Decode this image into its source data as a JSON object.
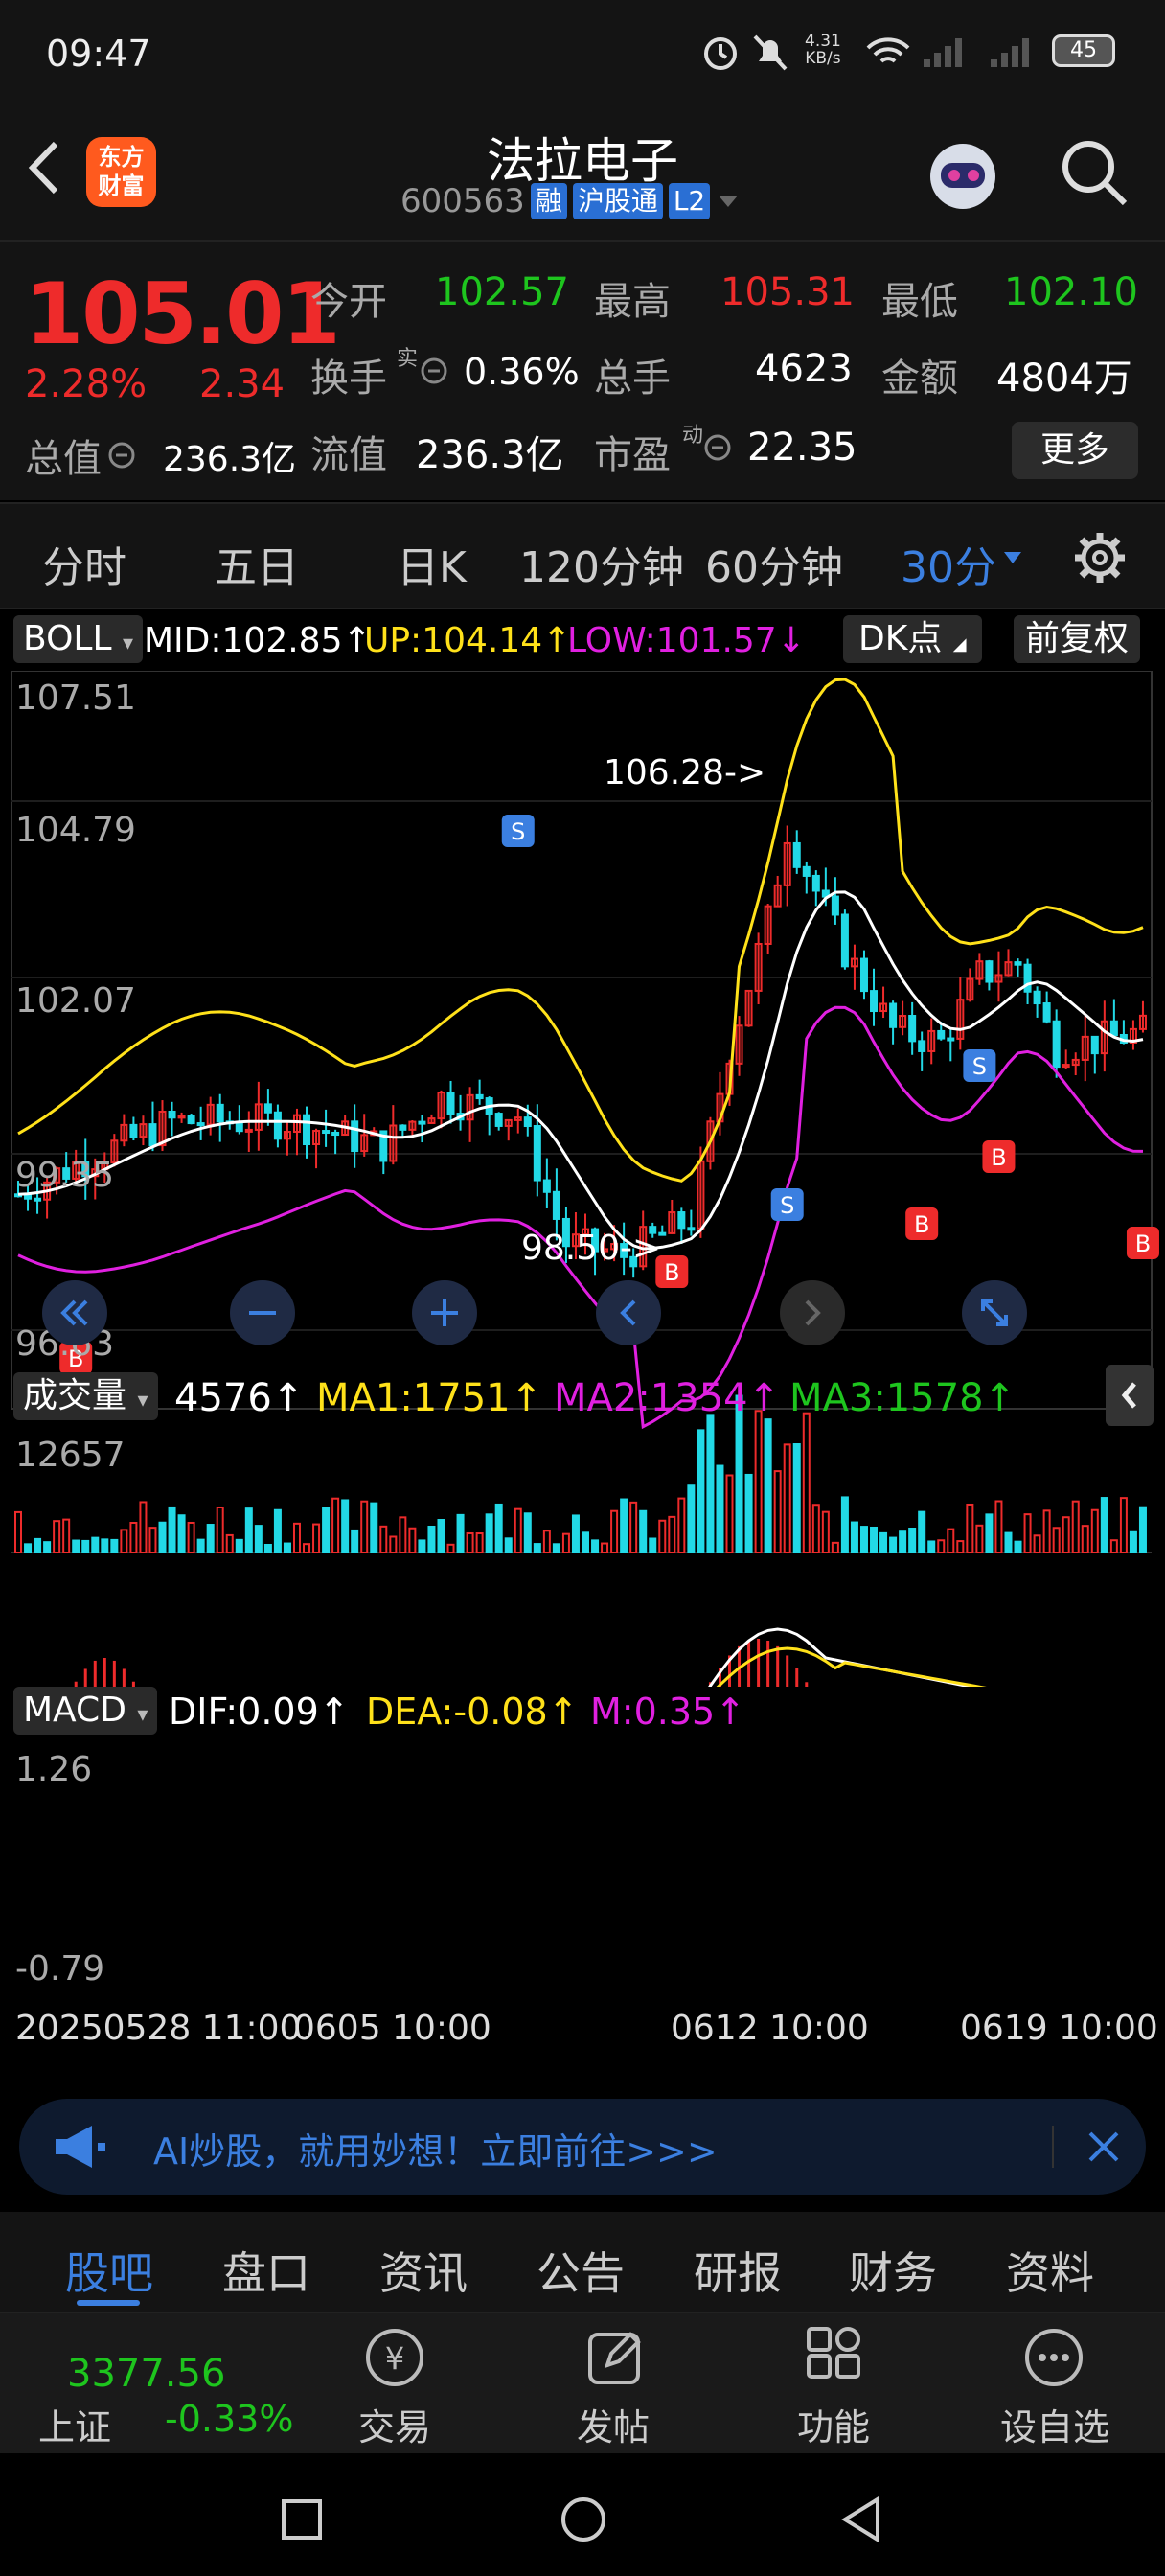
{
  "status": {
    "time": "09:47",
    "net_speed_top": "4.31",
    "net_speed_unit": "KB/s",
    "battery": "45"
  },
  "header": {
    "title": "法拉电子",
    "code": "600563",
    "tags": [
      "融",
      "沪股通",
      "L2"
    ],
    "logo_line1": "东方",
    "logo_line2": "财富"
  },
  "quote": {
    "price": "105.01",
    "change_pct": "2.28%",
    "change": "2.34",
    "open_label": "今开",
    "open": "102.57",
    "high_label": "最高",
    "high": "105.31",
    "low_label": "最低",
    "low": "102.10",
    "turnover_label": "换手",
    "turnover_sup": "实",
    "turnover": "0.36%",
    "volume_label": "总手",
    "volume": "4623",
    "amount_label": "金额",
    "amount": "4804万",
    "mcap_label": "总值",
    "mcap": "236.3亿",
    "float_label": "流值",
    "float": "236.3亿",
    "pe_label": "市盈",
    "pe_sup": "动",
    "pe": "22.35",
    "more": "更多"
  },
  "tabs": [
    "分时",
    "五日",
    "日K",
    "120分钟",
    "60分钟",
    "30分"
  ],
  "active_tab": "30分",
  "boll": {
    "name": "BOLL",
    "mid": "MID:102.85",
    "up": "UP:104.14",
    "low": "LOW:101.57",
    "dk": "DK点",
    "adjust": "前复权"
  },
  "price_axis": [
    "107.51",
    "104.79",
    "102.07",
    "99.35",
    "96.63"
  ],
  "annotations": {
    "high": "106.28->",
    "low": "98.50->"
  },
  "volume": {
    "name": "成交量",
    "value": "4576",
    "ma1": "MA1:1751",
    "ma2": "MA2:1354",
    "ma3": "MA3:1578",
    "axis_top": "12657"
  },
  "macd": {
    "name": "MACD",
    "dif": "DIF:0.09",
    "dea": "DEA:-0.08",
    "m": "M:0.35",
    "axis_top": "1.26",
    "axis_bottom": "-0.79"
  },
  "dates": [
    "20250528 11:00",
    "0605 10:00",
    "0612 10:00",
    "0619 10:00"
  ],
  "ad": {
    "text": "AI炒股，就用妙想！立即前往>>>"
  },
  "bottom_tabs": [
    "股吧",
    "盘口",
    "资讯",
    "公告",
    "研报",
    "财务",
    "资料"
  ],
  "index": {
    "value": "3377.56",
    "name": "上证",
    "change": "-0.33%"
  },
  "dock": [
    "交易",
    "发帖",
    "功能",
    "设自选"
  ],
  "colors": {
    "up": "#ee2b2b",
    "down": "#1ec51e",
    "accent": "#3b7fe0",
    "candle_down": "#22d9e6",
    "boll_up": "#ffe11a",
    "boll_low": "#e020e0"
  }
}
